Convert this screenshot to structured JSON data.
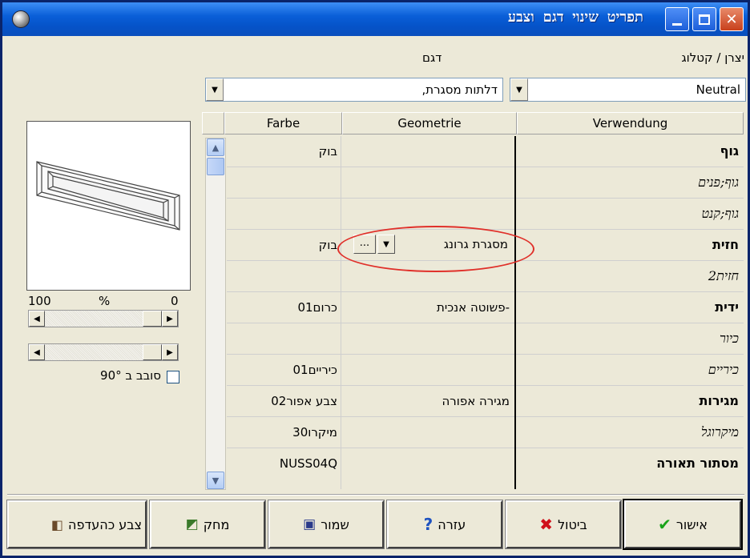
{
  "window": {
    "title": "תפריט שינוי דגם וצבע"
  },
  "catalog": {
    "label": "יצרן / קטלוג",
    "value": "Neutral"
  },
  "model": {
    "label": "דגם",
    "value": "דלתות מסגרת,"
  },
  "preview": {
    "percent_left": "100",
    "percent_mid": "%",
    "percent_right": "0",
    "rotate_label": "סובב ב 90°",
    "rotate_checked": false
  },
  "table": {
    "headers": [
      "Farbe",
      "Geometrie",
      "Verwendung"
    ],
    "rows": [
      {
        "farbe": "בוק",
        "geometrie": "",
        "verwendung": "גוף",
        "style": "bold"
      },
      {
        "farbe": "",
        "geometrie": "",
        "verwendung": "גוף;פנים",
        "style": "italic"
      },
      {
        "farbe": "",
        "geometrie": "",
        "verwendung": "גוף;קנט",
        "style": "italic"
      },
      {
        "farbe": "בוק",
        "geometrie": "מסגרת גרונג",
        "verwendung": "חזית",
        "style": "bold"
      },
      {
        "farbe": "",
        "geometrie": "",
        "verwendung": "חזית2",
        "style": "italic"
      },
      {
        "farbe": "כרום01",
        "geometrie": "-פשוטה אנכית",
        "verwendung": "ידית",
        "style": "bold"
      },
      {
        "farbe": "",
        "geometrie": "",
        "verwendung": "כיור",
        "style": "italic"
      },
      {
        "farbe": "כיריים01",
        "geometrie": "",
        "verwendung": "כיריים",
        "style": "italic"
      },
      {
        "farbe": "צבע אפור02",
        "geometrie": "מגירה אפורה",
        "verwendung": "מגירות",
        "style": "bold"
      },
      {
        "farbe": "מיקרו30",
        "geometrie": "",
        "verwendung": "מיקרוגל",
        "style": "italic"
      },
      {
        "farbe": "NUSS04Q",
        "geometrie": "",
        "verwendung": "מסתור תאורה",
        "style": "bold"
      }
    ],
    "editor": {
      "value": "מסגרת גרונג",
      "ellipsis": "..."
    }
  },
  "buttons": {
    "ok": "אישור",
    "cancel": "ביטול",
    "help": "עזרה",
    "save": "שמור",
    "delete": "מחק",
    "preference": "צבע כהעדפה"
  }
}
